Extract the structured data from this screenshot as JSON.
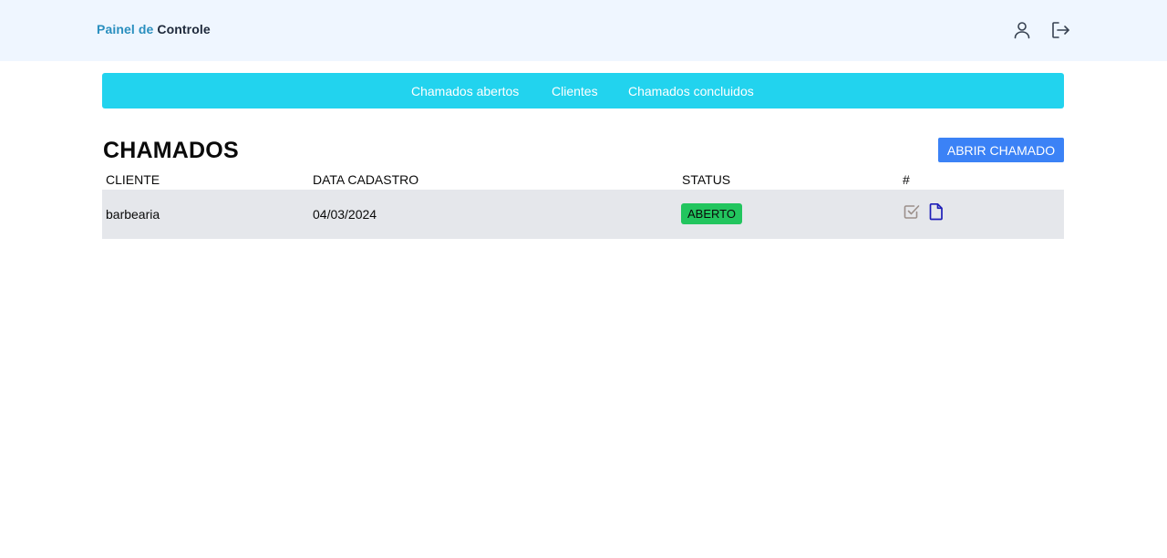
{
  "header": {
    "brand_part1": "Painel de",
    "brand_part2": "Controle",
    "icons": [
      "user-icon",
      "logout-icon"
    ]
  },
  "nav": {
    "items": [
      {
        "label": "Chamados abertos"
      },
      {
        "label": "Clientes"
      },
      {
        "label": "Chamados concluidos"
      }
    ],
    "color": "#22d3ee"
  },
  "main": {
    "title": "CHAMADOS",
    "open_button": "ABRIR CHAMADO",
    "columns": [
      "CLIENTE",
      "DATA CADASTRO",
      "STATUS",
      "#"
    ],
    "rows": [
      {
        "cliente": "barbearia",
        "data_cadastro": "04/03/2024",
        "status": "ABERTO",
        "status_color": "#22c55e",
        "actions": [
          "check-square-icon",
          "document-icon"
        ]
      }
    ]
  },
  "colors": {
    "header_bg": "#eff6ff",
    "button": "#3b82f6",
    "row_bg": "#e5e7eb"
  }
}
